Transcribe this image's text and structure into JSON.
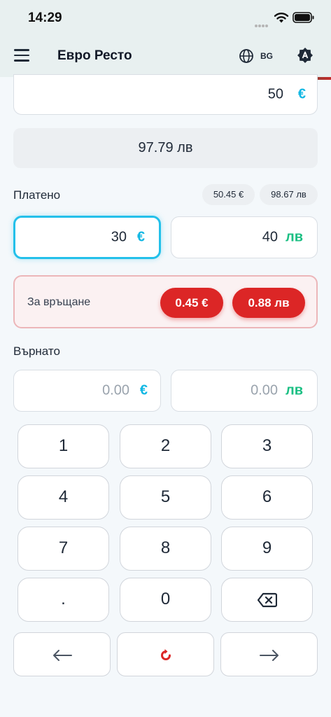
{
  "status": {
    "time": "14:29"
  },
  "appbar": {
    "title": "Евро Ресто",
    "lang": "BG"
  },
  "top_field": {
    "value": "50",
    "currency": "€"
  },
  "converted": {
    "text": "97.79 лв"
  },
  "paid": {
    "label": "Платено",
    "chips": [
      "50.45 €",
      "98.67 лв"
    ],
    "eur": {
      "value": "30",
      "currency": "€"
    },
    "bgn": {
      "value": "40",
      "currency": "лв"
    }
  },
  "change": {
    "label": "За връщане",
    "eur": "0.45 €",
    "bgn": "0.88 лв"
  },
  "returned": {
    "label": "Върнато",
    "eur": {
      "value": "0.00",
      "currency": "€"
    },
    "bgn": {
      "value": "0.00",
      "currency": "лв"
    }
  },
  "keypad": {
    "keys": [
      "1",
      "2",
      "3",
      "4",
      "5",
      "6",
      "7",
      "8",
      "9",
      ".",
      "0"
    ]
  },
  "colors": {
    "eur": "#11b7e3",
    "bgn": "#1bbf83",
    "alert": "#dc2626",
    "focus": "#23c0ea"
  }
}
